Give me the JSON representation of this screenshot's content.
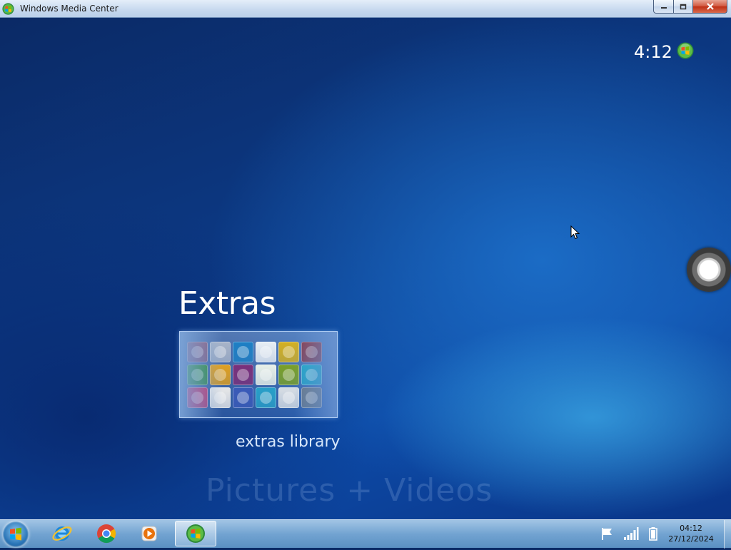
{
  "window": {
    "title": "Windows Media Center",
    "buttons": [
      "minimize",
      "maximize",
      "close"
    ]
  },
  "media_center": {
    "clock": "4:12",
    "category": "Extras",
    "selected_item_label": "extras library",
    "next_category": "Pictures + Videos",
    "background_colors": [
      "#0b2a66",
      "#0d4aa6",
      "#3caae6"
    ],
    "tile_colors": [
      "#8a5a7a",
      "#a8b4c8",
      "#1d7fc4",
      "#e8eef4",
      "#d4b020",
      "#8a3a4a",
      "#2d8a3a",
      "#e0a020",
      "#7a2f7a",
      "#e8f0e8",
      "#7aa028",
      "#1fa8c8",
      "#c0306a",
      "#e8e8e8",
      "#3a5ab8",
      "#28a0c8",
      "#d8dee4",
      "#6a7a8a"
    ]
  },
  "taskbar": {
    "pinned": [
      {
        "name": "internet-explorer",
        "active": false
      },
      {
        "name": "google-chrome",
        "active": false
      },
      {
        "name": "windows-media-player",
        "active": false
      },
      {
        "name": "windows-media-center",
        "active": true
      }
    ],
    "tray_icons": [
      "action-center-flag-icon",
      "network-signal-icon",
      "battery-icon"
    ],
    "time": "04:12",
    "date": "27/12/2024"
  }
}
